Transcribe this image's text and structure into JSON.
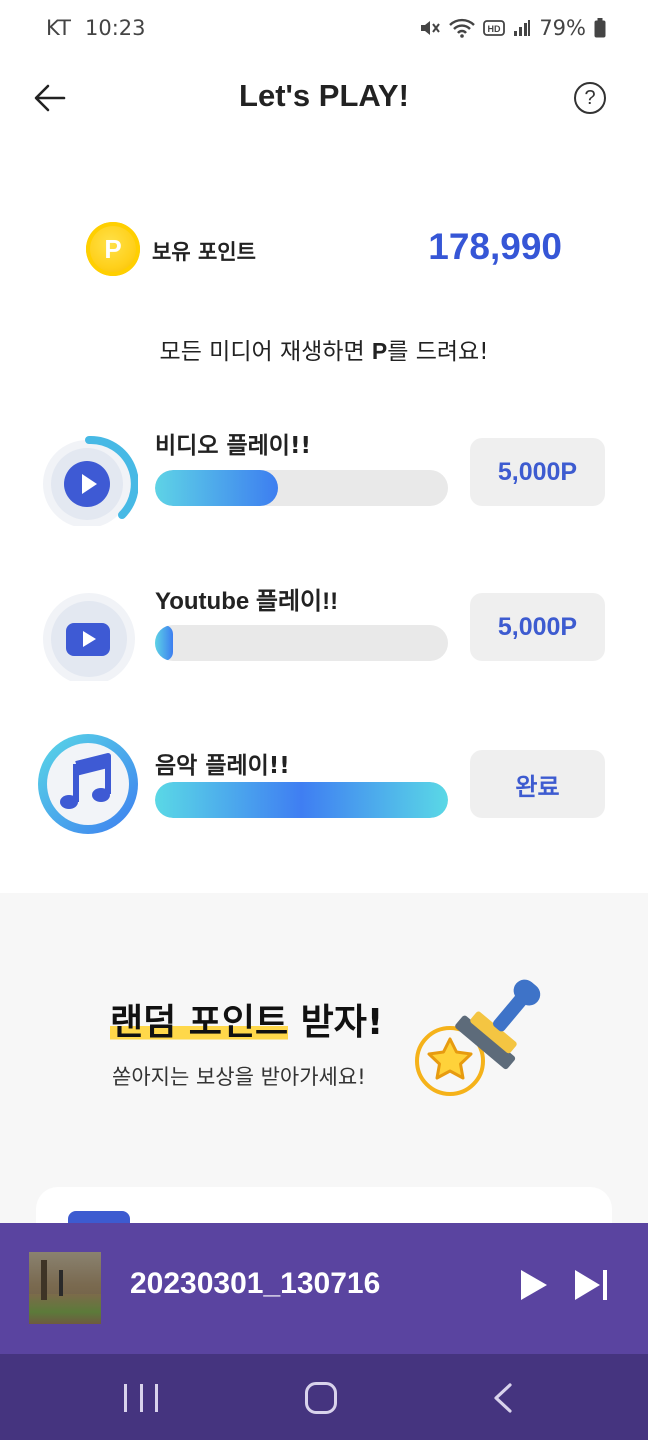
{
  "status_bar": {
    "carrier": "KT",
    "time": "10:23",
    "battery": "79%"
  },
  "header": {
    "title": "Let's PLAY!"
  },
  "points": {
    "label": "보유 포인트",
    "coin_letter": "P",
    "value": "178,990"
  },
  "subtitle": {
    "before": "모든 미디어 재생하면 ",
    "bold": "P",
    "after": "를 드려요!"
  },
  "plays": [
    {
      "title": "비디오 플레이!!",
      "reward": "5,000P",
      "progress": 0.42
    },
    {
      "title": "Youtube 플레이!!",
      "reward": "5,000P",
      "progress": 0.06
    },
    {
      "title": "음악 플레이!!",
      "reward": "완료",
      "progress": 1.0
    }
  ],
  "random": {
    "title_highlight": "랜덤 포인트",
    "title_rest": " 받자!",
    "description": "쏟아지는 보상을 받아가세요!"
  },
  "mini_player": {
    "track": "20230301_130716"
  },
  "colors": {
    "accent": "#3d5bd0",
    "player_bg": "#5a44a0",
    "nav_bg": "#45347f",
    "progress_start": "#5ed3e6",
    "progress_end": "#3d7ef0"
  }
}
